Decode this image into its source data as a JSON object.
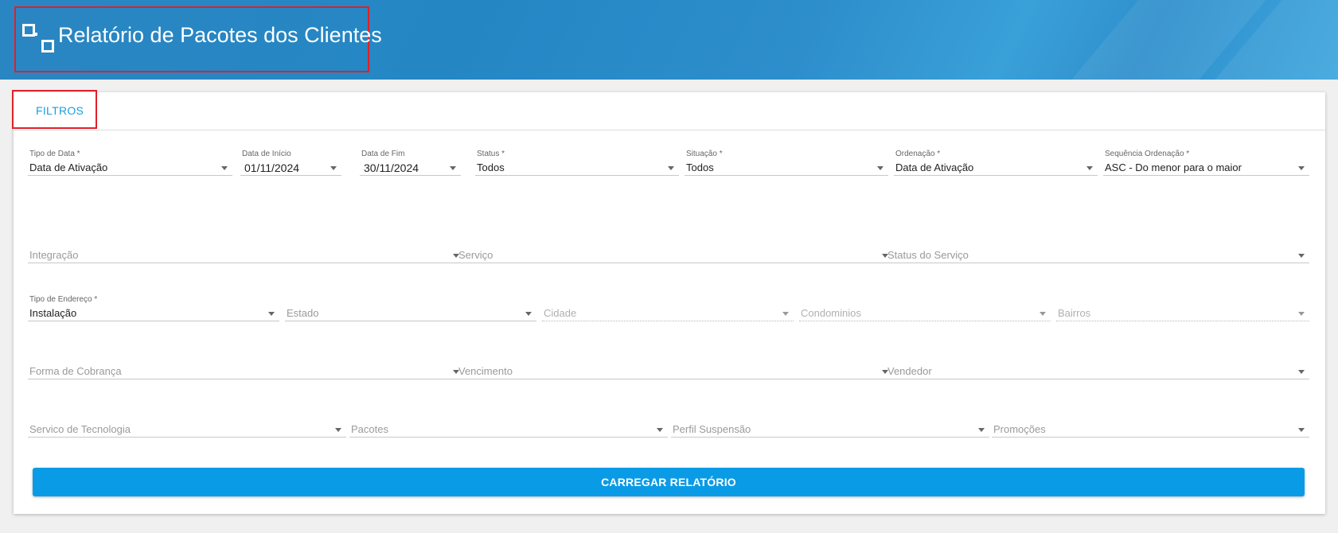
{
  "header": {
    "title": "Relatório de Pacotes dos Clientes"
  },
  "tabs": [
    {
      "label": "FILTROS"
    }
  ],
  "row1": [
    {
      "label": "Tipo de Data *",
      "value": "Data de Ativação"
    },
    {
      "label": "Data de Início",
      "value": "01/11/2024"
    },
    {
      "label": "Data de Fim",
      "value": "30/11/2024"
    },
    {
      "label": "Status *",
      "value": "Todos"
    },
    {
      "label": "Situação *",
      "value": "Todos"
    },
    {
      "label": "Ordenação *",
      "value": "Data de Ativação"
    },
    {
      "label": "Sequência Ordenação *",
      "value": "ASC - Do menor para o maior"
    }
  ],
  "row2": [
    {
      "placeholder": "Integração"
    },
    {
      "placeholder": "Serviço"
    },
    {
      "placeholder": "Status do Serviço"
    }
  ],
  "row3": [
    {
      "label": "Tipo de Endereço *",
      "value": "Instalação"
    },
    {
      "placeholder": "Estado"
    },
    {
      "placeholder": "Cidade"
    },
    {
      "placeholder": "Condominios"
    },
    {
      "placeholder": "Bairros"
    }
  ],
  "row4": [
    {
      "placeholder": "Forma de Cobrança"
    },
    {
      "placeholder": "Vencimento"
    },
    {
      "placeholder": "Vendedor"
    }
  ],
  "row5": [
    {
      "placeholder": "Servico de Tecnologia"
    },
    {
      "placeholder": "Pacotes"
    },
    {
      "placeholder": "Perfil Suspensão"
    },
    {
      "placeholder": "Promoções"
    }
  ],
  "actions": {
    "load_report": "CARREGAR RELATÓRIO"
  },
  "colors": {
    "header": "#2487c4",
    "accent": "#1a9de0",
    "button": "#0a9be6",
    "highlight": "#e0202a"
  }
}
